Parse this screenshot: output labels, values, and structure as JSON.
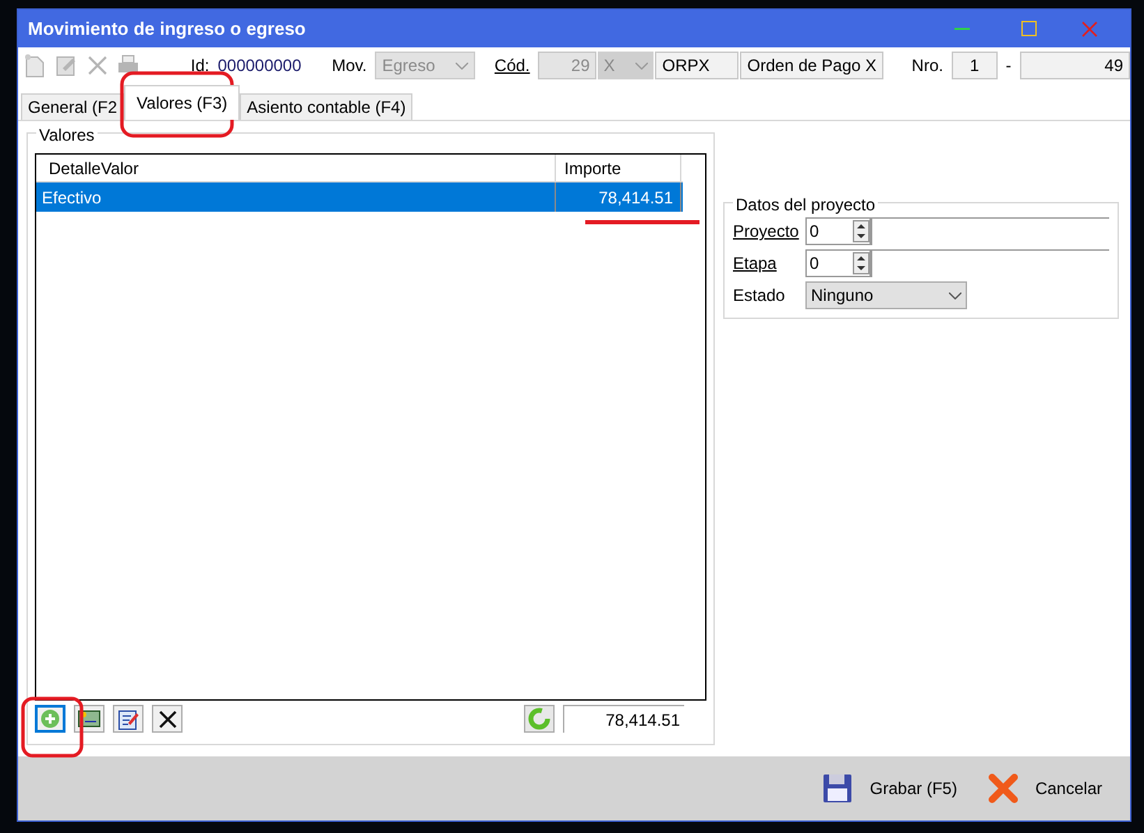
{
  "window": {
    "title": "Movimiento de ingreso o egreso"
  },
  "toolbar": {
    "tools": [
      {
        "kind": "new",
        "disabled": true
      },
      {
        "kind": "edit",
        "disabled": true
      },
      {
        "kind": "delete",
        "disabled": true
      },
      {
        "kind": "print",
        "disabled": true
      }
    ],
    "id_label": "Id:",
    "id_value": "000000000",
    "mov_label": "Mov.",
    "mov_value": "Egreso",
    "mov_disabled": true,
    "cod_label": "Cód.",
    "cod_value": "29",
    "cod_type": "X",
    "cod_code": "ORPX",
    "cod_name": "Orden de Pago X",
    "nro_label": "Nro.",
    "nro_value": "1",
    "nro_sep": "-",
    "nro_number": "49"
  },
  "tabs": [
    {
      "label": "General (F2",
      "selected": false
    },
    {
      "label": "Valores (F3)",
      "selected": true
    },
    {
      "label": "Asiento contable (F4)",
      "selected": false
    }
  ],
  "valores": {
    "title": "Valores",
    "columns": [
      "DetalleValor",
      "Importe"
    ],
    "rows": [
      {
        "cells": [
          "Efectivo",
          "78,414.51"
        ],
        "selected": true
      }
    ],
    "actions": [
      {
        "kind": "add",
        "focused": true
      },
      {
        "kind": "card",
        "focused": false
      },
      {
        "kind": "edit",
        "focused": false
      },
      {
        "kind": "delete",
        "focused": false
      }
    ],
    "total": "78,414.51"
  },
  "proyecto": {
    "title": "Datos del proyecto",
    "fields": [
      {
        "kind": "spin",
        "label": "Proyecto",
        "value": "0"
      },
      {
        "kind": "spin",
        "label": "Etapa",
        "value": "0"
      },
      {
        "kind": "select",
        "label": "Estado",
        "value": "Ninguno"
      }
    ]
  },
  "footer": {
    "buttons": [
      {
        "kind": "save",
        "label": "Grabar (F5)"
      },
      {
        "kind": "cancel",
        "label": "Cancelar"
      }
    ]
  }
}
